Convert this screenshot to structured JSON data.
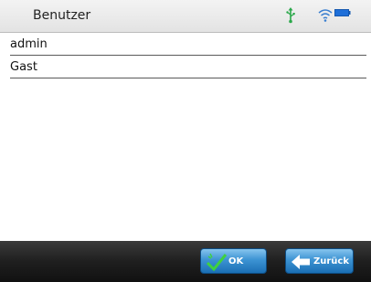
{
  "header": {
    "title": "Benutzer",
    "status_icons": [
      "usb-icon",
      "wifi-icon",
      "battery-icon"
    ]
  },
  "users": [
    {
      "label": "admin"
    },
    {
      "label": "Gast"
    }
  ],
  "footer": {
    "ok_label": "OK",
    "back_label": "Zurück",
    "ok_icon": "check-icon",
    "back_icon": "back-arrow-icon"
  },
  "colors": {
    "button_blue": "#3c93d3",
    "footer_bg": "#1f1f1f",
    "check_green": "#3fd13f",
    "battery_blue": "#1e6fd9",
    "usb_green": "#2aa84a"
  }
}
